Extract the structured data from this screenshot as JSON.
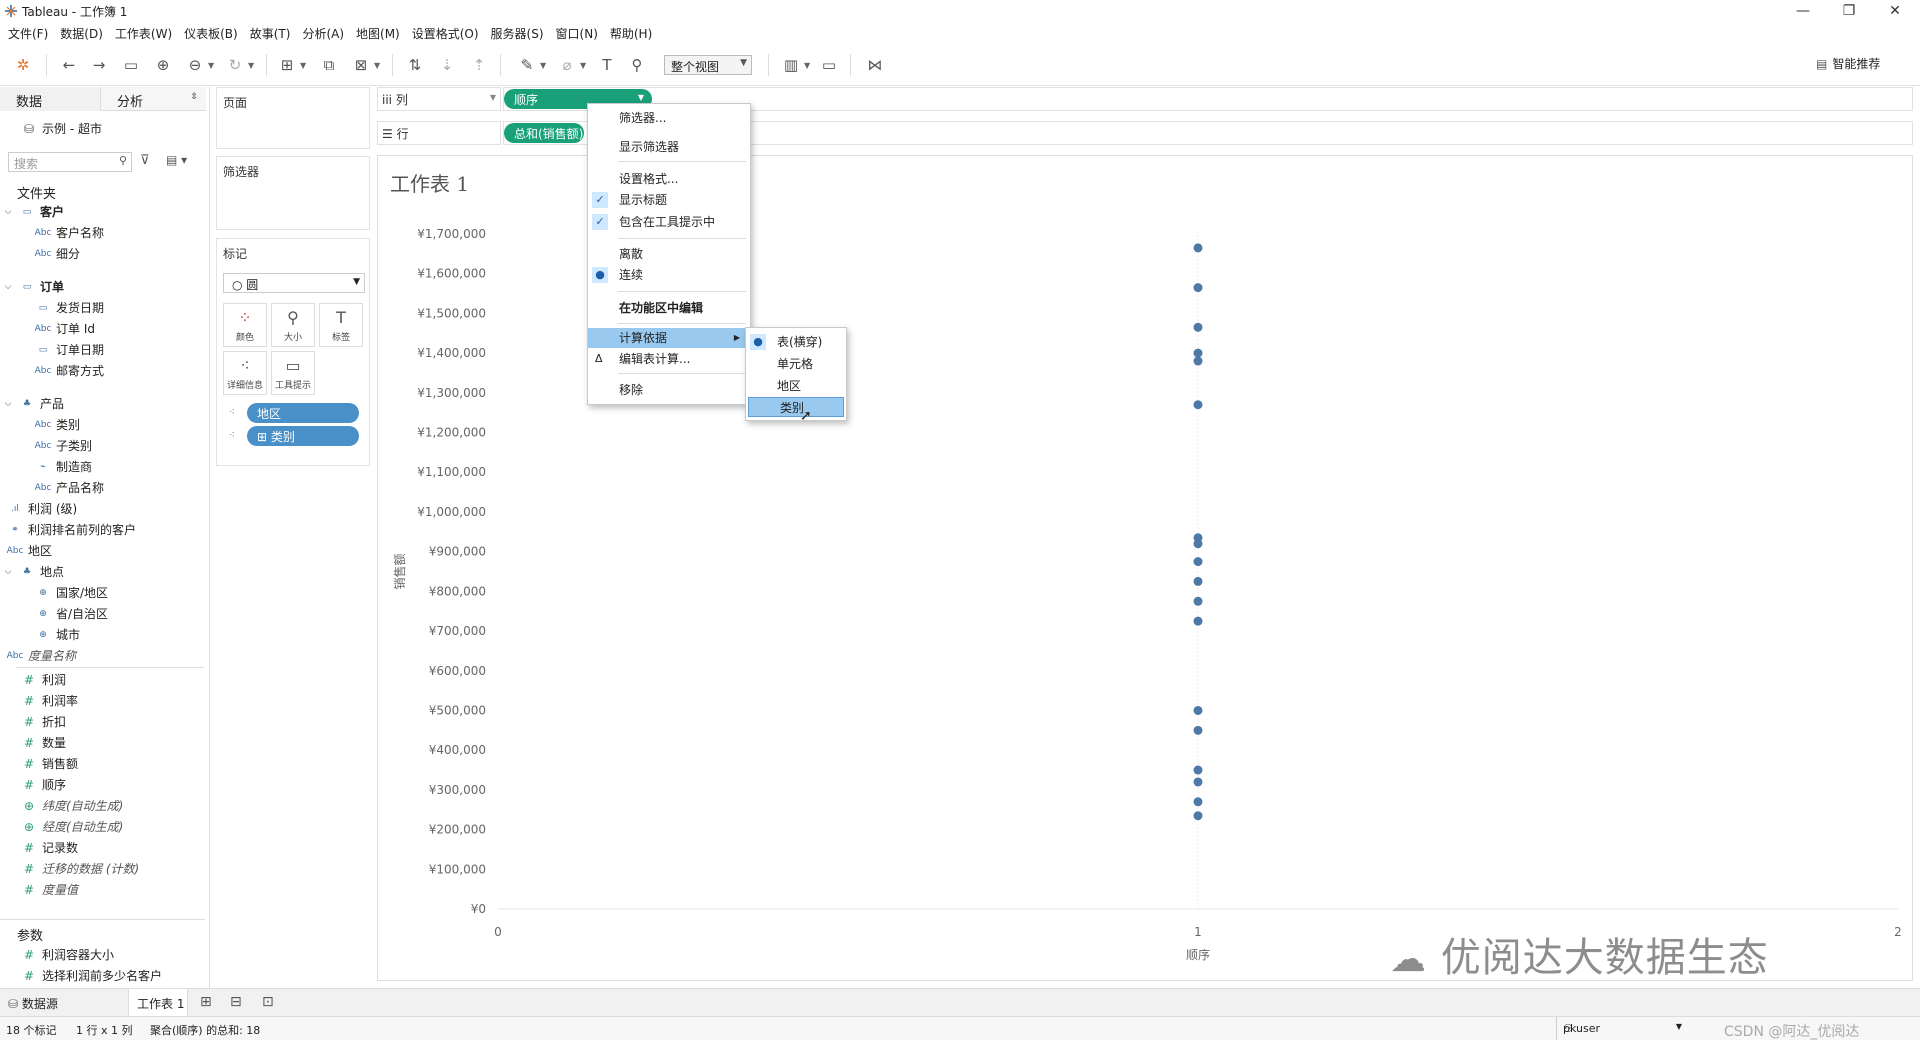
{
  "window": {
    "title": "Tableau - 工作簿 1"
  },
  "menubar": [
    "文件(F)",
    "数据(D)",
    "工作表(W)",
    "仪表板(B)",
    "故事(T)",
    "分析(A)",
    "地图(M)",
    "设置格式(O)",
    "服务器(S)",
    "窗口(N)",
    "帮助(H)"
  ],
  "toolbar": {
    "fit_value": "整个视图",
    "smart_label": "智能推荐"
  },
  "datapane": {
    "tab_data": "数据",
    "tab_analysis": "分析",
    "datasource": "示例 - 超市",
    "search_placeholder": "搜索",
    "folders_label": "文件夹",
    "items": [
      {
        "icon": "folder-icon",
        "label": "客户",
        "kind": "folder",
        "bold": true
      },
      {
        "icon": "abc",
        "label": "客户名称",
        "kind": "dim"
      },
      {
        "icon": "abc",
        "label": "细分",
        "kind": "dim"
      },
      {
        "icon": "folder-icon",
        "label": "订单",
        "kind": "folder",
        "bold": true
      },
      {
        "icon": "date",
        "label": "发货日期",
        "kind": "dim"
      },
      {
        "icon": "abc",
        "label": "订单 Id",
        "kind": "dim"
      },
      {
        "icon": "date",
        "label": "订单日期",
        "kind": "dim"
      },
      {
        "icon": "abc",
        "label": "邮寄方式",
        "kind": "dim"
      },
      {
        "icon": "hier",
        "label": "产品",
        "kind": "hier"
      },
      {
        "icon": "abc",
        "label": "类别",
        "kind": "dim"
      },
      {
        "icon": "abc",
        "label": "子类别",
        "kind": "dim"
      },
      {
        "icon": "clip",
        "label": "制造商",
        "kind": "dim"
      },
      {
        "icon": "abc",
        "label": "产品名称",
        "kind": "dim"
      },
      {
        "icon": "bin",
        "label": "利润 (级)",
        "kind": "top"
      },
      {
        "icon": "set",
        "label": "利润排名前列的客户",
        "kind": "top"
      },
      {
        "icon": "abc",
        "label": "地区",
        "kind": "top"
      },
      {
        "icon": "hier",
        "label": "地点",
        "kind": "hier"
      },
      {
        "icon": "globe",
        "label": "国家/地区",
        "kind": "dim"
      },
      {
        "icon": "globe",
        "label": "省/自治区",
        "kind": "dim"
      },
      {
        "icon": "globe",
        "label": "城市",
        "kind": "dim"
      },
      {
        "icon": "abc",
        "label": "度量名称",
        "kind": "top",
        "italic": true
      },
      {
        "icon": "hash",
        "label": "利润",
        "kind": "measure"
      },
      {
        "icon": "hash",
        "label": "利润率",
        "kind": "measure"
      },
      {
        "icon": "hash",
        "label": "折扣",
        "kind": "measure"
      },
      {
        "icon": "hash",
        "label": "数量",
        "kind": "measure"
      },
      {
        "icon": "hash",
        "label": "销售额",
        "kind": "measure"
      },
      {
        "icon": "hash",
        "label": "顺序",
        "kind": "measure"
      },
      {
        "icon": "globe",
        "label": "纬度(自动生成)",
        "kind": "measure",
        "italic": true
      },
      {
        "icon": "globe",
        "label": "经度(自动生成)",
        "kind": "measure",
        "italic": true
      },
      {
        "icon": "hash",
        "label": "记录数",
        "kind": "measure"
      },
      {
        "icon": "hash",
        "label": "迁移的数据 (计数)",
        "kind": "measure",
        "italic": true
      },
      {
        "icon": "hash",
        "label": "度量值",
        "kind": "measure",
        "italic": true
      }
    ],
    "params_label": "参数",
    "params": [
      {
        "icon": "hash",
        "label": "利润容器大小"
      },
      {
        "icon": "hash",
        "label": "选择利润前多少名客户"
      }
    ]
  },
  "shelves": {
    "pages": "页面",
    "filters": "筛选器",
    "marks": "标记",
    "mark_type": "圆",
    "mark_buttons": [
      "颜色",
      "大小",
      "标签",
      "详细信息",
      "工具提示"
    ],
    "mark_pills": [
      "地区",
      "类别"
    ],
    "columns_label": "列",
    "rows_label": "行",
    "columns_pill": "顺序",
    "rows_pill": "总和(销售额)"
  },
  "sheet": {
    "title": "工作表 1"
  },
  "chart_data": {
    "type": "scatter",
    "xlabel": "顺序",
    "ylabel": "销售额",
    "xlim": [
      0,
      2
    ],
    "x_ticks": [
      "0",
      "1",
      "2"
    ],
    "ylim": [
      0,
      1700000
    ],
    "y_ticks": [
      "¥0",
      "¥100,000",
      "¥200,000",
      "¥300,000",
      "¥400,000",
      "¥500,000",
      "¥600,000",
      "¥700,000",
      "¥800,000",
      "¥900,000",
      "¥1,000,000",
      "¥1,100,000",
      "¥1,200,000",
      "¥1,300,000",
      "¥1,400,000",
      "¥1,500,000",
      "¥1,600,000",
      "¥1,700,000"
    ],
    "point_color": "#4e79a7",
    "x": [
      1,
      1,
      1,
      1,
      1,
      1,
      1,
      1,
      1,
      1,
      1,
      1,
      1,
      1,
      1,
      1,
      1,
      1
    ],
    "y": [
      1665000,
      1565000,
      1465000,
      1400000,
      1380000,
      1270000,
      935000,
      920000,
      875000,
      825000,
      775000,
      725000,
      500000,
      450000,
      350000,
      320000,
      270000,
      235000
    ]
  },
  "context_menu": {
    "items": [
      "筛选器...",
      "显示筛选器",
      "设置格式...",
      "显示标题",
      "包含在工具提示中",
      "离散",
      "连续",
      "在功能区中编辑",
      "计算依据",
      "编辑表计算...",
      "移除"
    ],
    "checked": [
      "显示标题",
      "包含在工具提示中"
    ],
    "selected_radio": "连续"
  },
  "submenu": {
    "items": [
      "表(横穿)",
      "单元格",
      "地区",
      "类别"
    ],
    "selected_radio": "表(横穿)",
    "highlighted": "类别"
  },
  "tabs": {
    "datasource": "数据源",
    "sheet": "工作表 1"
  },
  "status": {
    "marks": "18 个标记",
    "rows_cols": "1 行 x 1 列",
    "sum": "聚合(顺序) 的总和: 18",
    "user": "pkuser"
  },
  "watermark": "优阅达大数据生态",
  "credit": "CSDN @阿达_优阅达"
}
